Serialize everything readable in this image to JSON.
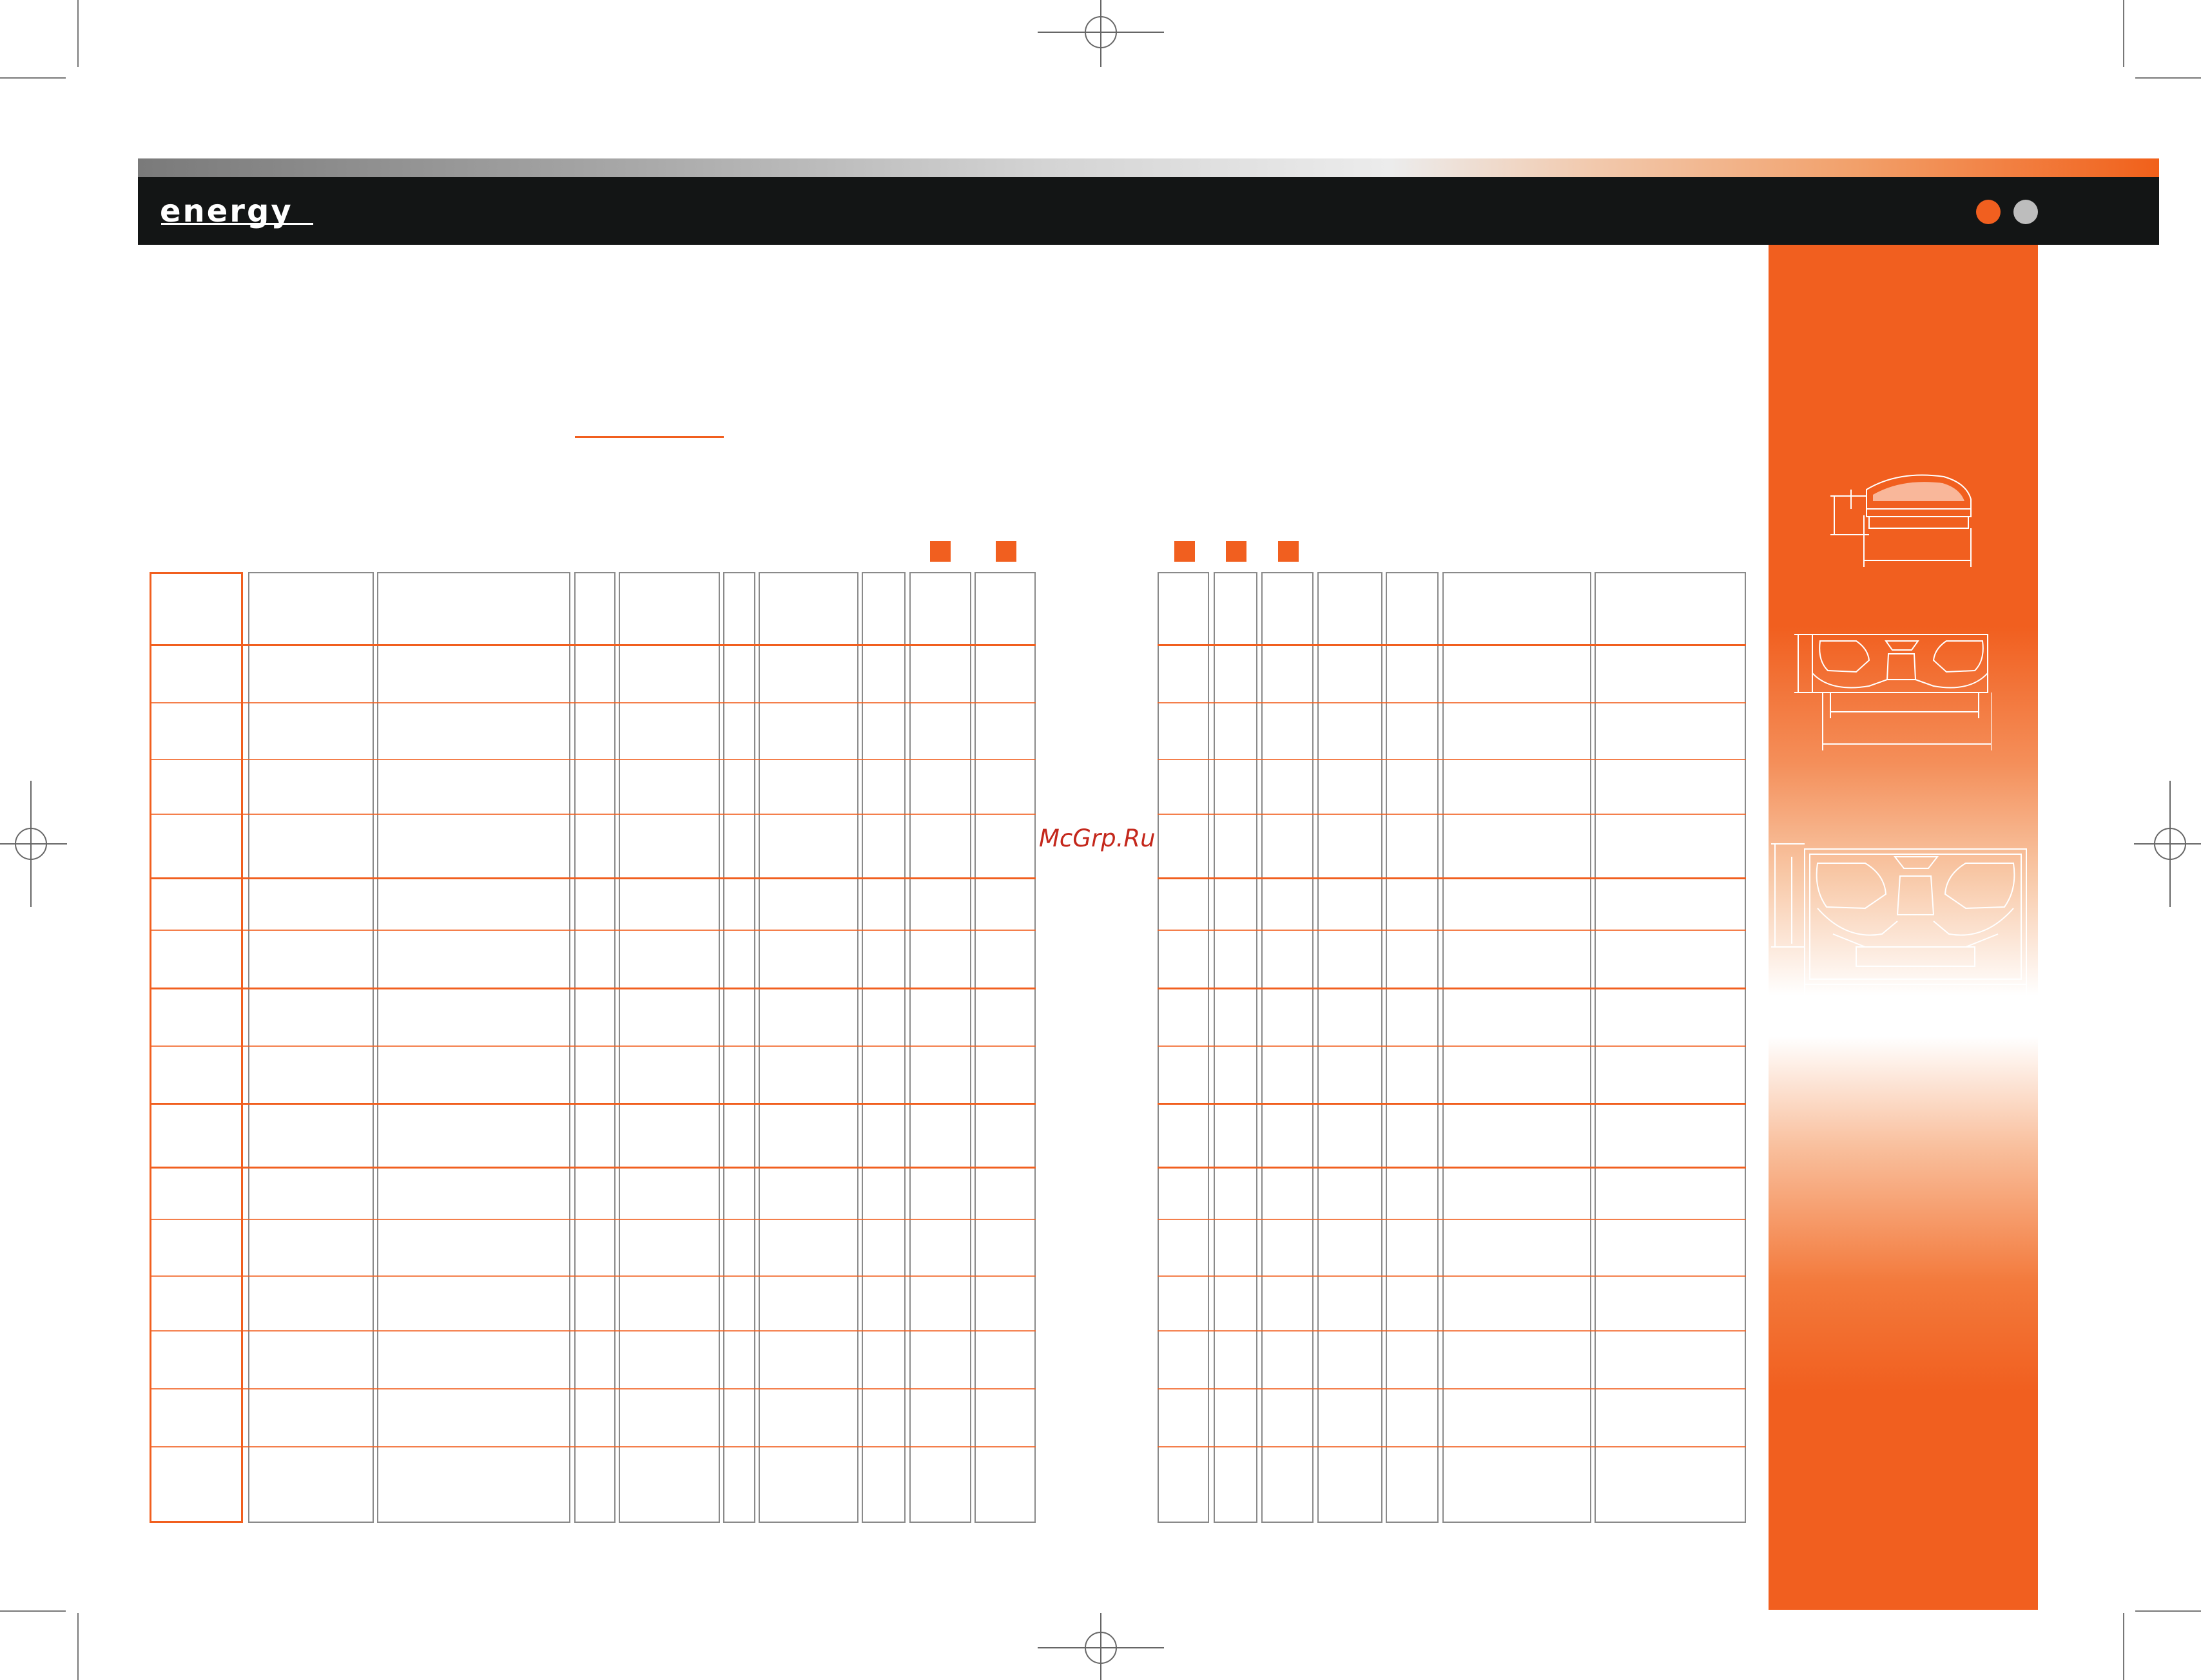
{
  "header": {
    "logo_text": "energy",
    "dot_colors": [
      "#f15f1f",
      "#bdbdbd"
    ]
  },
  "accent_color": "#f15f1f",
  "side_panel": {
    "color": "#f15f1f",
    "drawings": [
      "tweeter-drawing",
      "coaxial-speaker-drawing",
      "oval-speaker-drawing"
    ]
  },
  "legend_squares": 5,
  "watermark": "McGrp.Ru"
}
